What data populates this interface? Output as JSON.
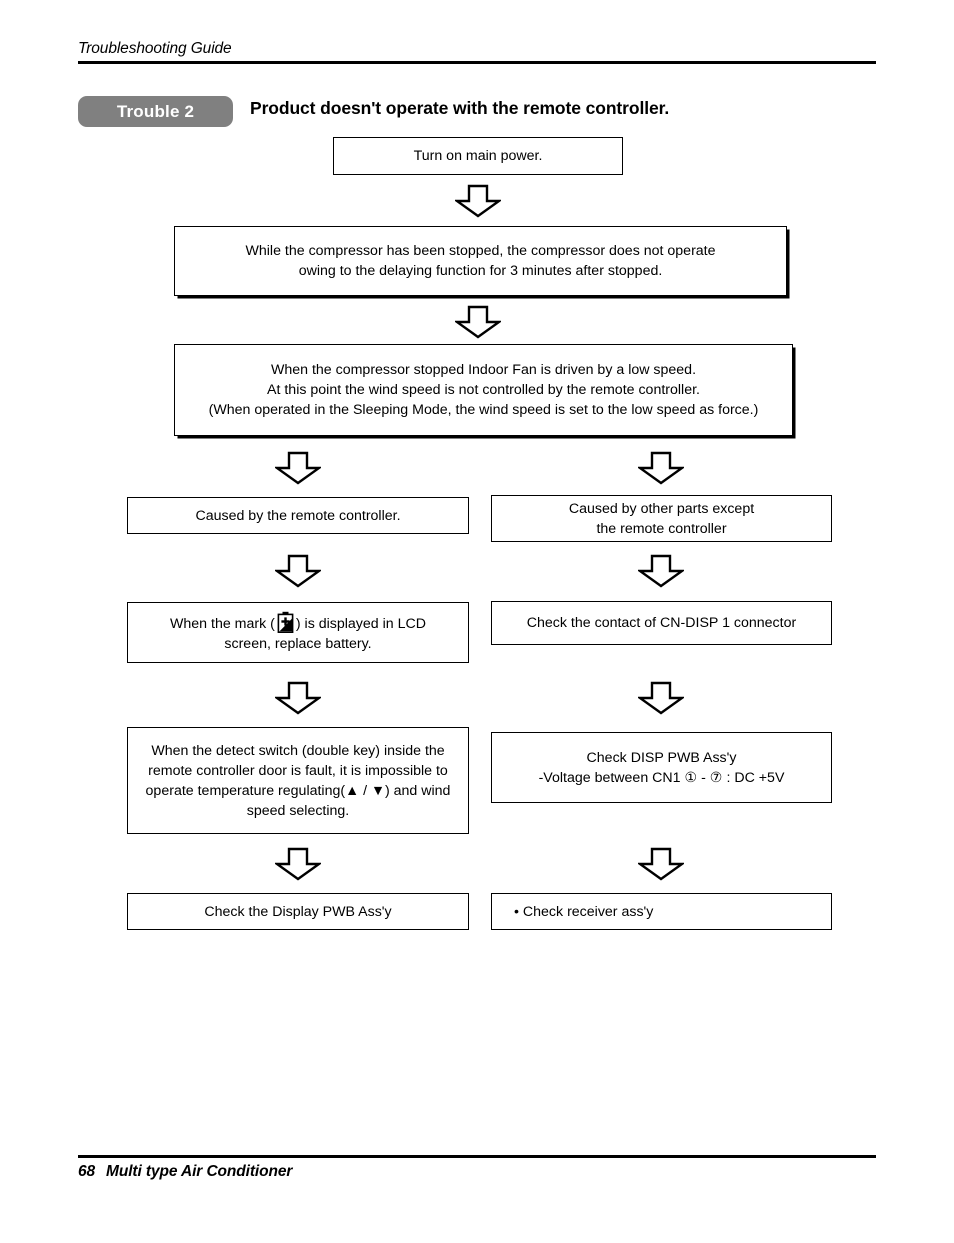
{
  "header": {
    "guide_title": "Troubleshooting Guide"
  },
  "trouble": {
    "badge_label": "Trouble 2",
    "heading": "Product doesn't operate with the remote controller.",
    "badge_color": "#808080",
    "badge_text_color": "#ffffff"
  },
  "flow": {
    "step1": {
      "text": "Turn on main power."
    },
    "step2": {
      "line1": "While the compressor has been stopped, the compressor does not operate",
      "line2": "owing to the delaying function for 3 minutes after stopped."
    },
    "step3": {
      "line1": "When the compressor stopped Indoor Fan is driven by a low speed.",
      "line2": "At this point the wind speed is not controlled by the remote controller.",
      "line3": "(When operated in the Sleeping Mode, the wind speed is set to the low speed as force.)"
    },
    "left_column": {
      "box1": {
        "text": "Caused by the remote controller."
      },
      "box2": {
        "prefix": "When the mark (",
        "suffix": ") is displayed in LCD",
        "line2": "screen, replace battery.",
        "icon": "battery-low-icon"
      },
      "box3": {
        "line1": "When the detect switch (double key) inside the",
        "line2": "remote controller door is fault, it is impossible to",
        "line3": "operate temperature regulating(▲ / ▼) and wind",
        "line4": "speed selecting."
      },
      "box4": {
        "text": "Check the Display PWB Ass'y"
      }
    },
    "right_column": {
      "box1": {
        "line1": "Caused by other parts except",
        "line2": "the remote controller"
      },
      "box2": {
        "text": "Check the contact of CN-DISP 1 connector"
      },
      "box3": {
        "line1": "Check DISP PWB Ass'y",
        "line2": "-Voltage between CN1 ① - ⑦ : DC +5V"
      },
      "box4": {
        "text": "• Check receiver ass'y"
      }
    },
    "arrow_icon": "down-block-arrow-icon"
  },
  "footer": {
    "page_number": "68",
    "document_title": "Multi type Air Conditioner"
  }
}
